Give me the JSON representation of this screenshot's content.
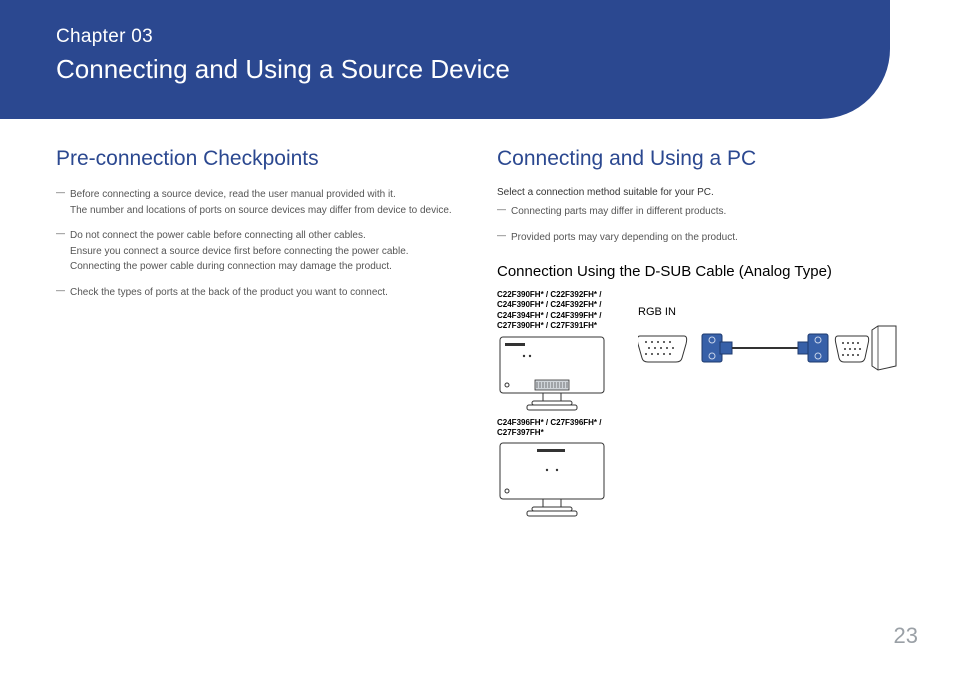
{
  "banner": {
    "chapter": "Chapter  03",
    "title": "Connecting and Using a Source Device"
  },
  "left": {
    "heading": "Pre-connection Checkpoints",
    "items": [
      "Before connecting a source device, read the user manual provided with it.\nThe number and locations of ports on source devices may differ from device to device.",
      "Do not connect the power cable before connecting all other cables.\nEnsure you connect a source device first before connecting the power cable.\nConnecting the power cable during connection may damage the product.",
      "Check the types of ports at the back of the product you want to connect."
    ]
  },
  "right": {
    "heading": "Connecting and Using a PC",
    "intro": "Select a connection method suitable for your PC.",
    "notes": [
      "Connecting parts may differ in different products.",
      "Provided ports may vary depending on the product."
    ],
    "sub_heading": "Connection Using the D-SUB Cable (Analog Type)",
    "models_top": "C22F390FH* / C22F392FH* / C24F390FH* / C24F392FH* / C24F394FH* / C24F399FH* /  C27F390FH* / C27F391FH*",
    "models_bottom": "C24F396FH* / C27F396FH* / C27F397FH*",
    "port_label": "RGB IN"
  },
  "page_number": "23",
  "colors": {
    "brand_blue": "#2b4890",
    "vga_blue": "#3760a8"
  }
}
